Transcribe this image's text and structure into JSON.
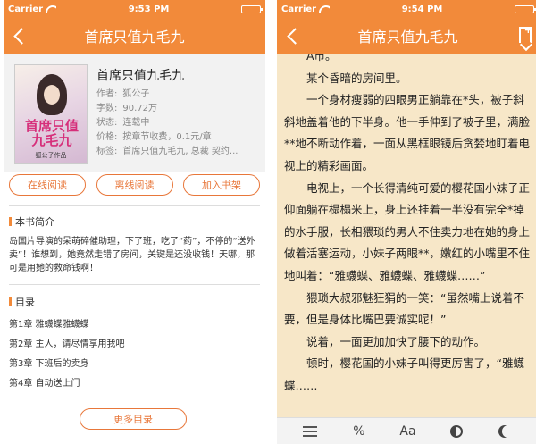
{
  "status": {
    "carrier": "Carrier",
    "left_time": "9:53 PM",
    "right_time": "9:54 PM"
  },
  "book": {
    "title": "首席只值九毛九",
    "cover_title": "首席只值九毛九",
    "cover_author": "狐公子作品",
    "meta": [
      {
        "k": "作者:",
        "v": "狐公子"
      },
      {
        "k": "字数:",
        "v": "90.72万"
      },
      {
        "k": "状态:",
        "v": "连载中"
      },
      {
        "k": "价格:",
        "v": "按章节收费，0.1元/章"
      },
      {
        "k": "标签:",
        "v": "首席只值九毛九, 总裁 契约..."
      }
    ],
    "actions": [
      "在线阅读",
      "离线阅读",
      "加入书架"
    ]
  },
  "intro": {
    "heading": "本书简介",
    "text": "岛国片导演的呆萌碎催助理，下了班，吃了“药”，不停的“送外卖”！谁想到，她竟然走错了房间，关键是还没收钱！天哪，那可是用她的救命钱啊！"
  },
  "catalog": {
    "heading": "目录",
    "chapters": [
      "第1章 雅蠛蝶雅蠛蝶",
      "第2章 主人，请尽情享用我吧",
      "第3章 下班后的卖身",
      "第4章 自动送上门"
    ],
    "more": "更多目录"
  },
  "reader": {
    "title": "首席只值九毛九",
    "paragraphs": [
      "A市。",
      "某个昏暗的房间里。",
      "一个身材瘦弱的四眼男正躺靠在*头，被子斜斜地盖着他的下半身。他一手伸到了被子里，满脸**地不断动作着，一面从黑框眼镜后贪婪地盯着电视上的精彩画面。",
      "电视上，一个长得清纯可爱的樱花国小妹子正仰面躺在榻榻米上，身上还挂着一半没有完全*掉的水手服，长相猥琐的男人不住卖力地在她的身上做着活塞运动，小妹子两眼**，嫩红的小嘴里不住地叫着：“雅蠛蝶、雅蠛蝶、雅蠛蝶……”",
      "猥琐大叔邪魅狂狷的一笑：“虽然嘴上说着不要，但是身体比嘴巴要诚实呢！”",
      "说着，一面更加加快了腰下的动作。",
      "顿时，樱花国的小妹子叫得更厉害了，“雅蠛蝶……"
    ],
    "toolbar": {
      "percent": "%",
      "font": "Aa"
    }
  },
  "colors": {
    "accent": "#f28a3a",
    "paper": "#f7e7c8"
  }
}
